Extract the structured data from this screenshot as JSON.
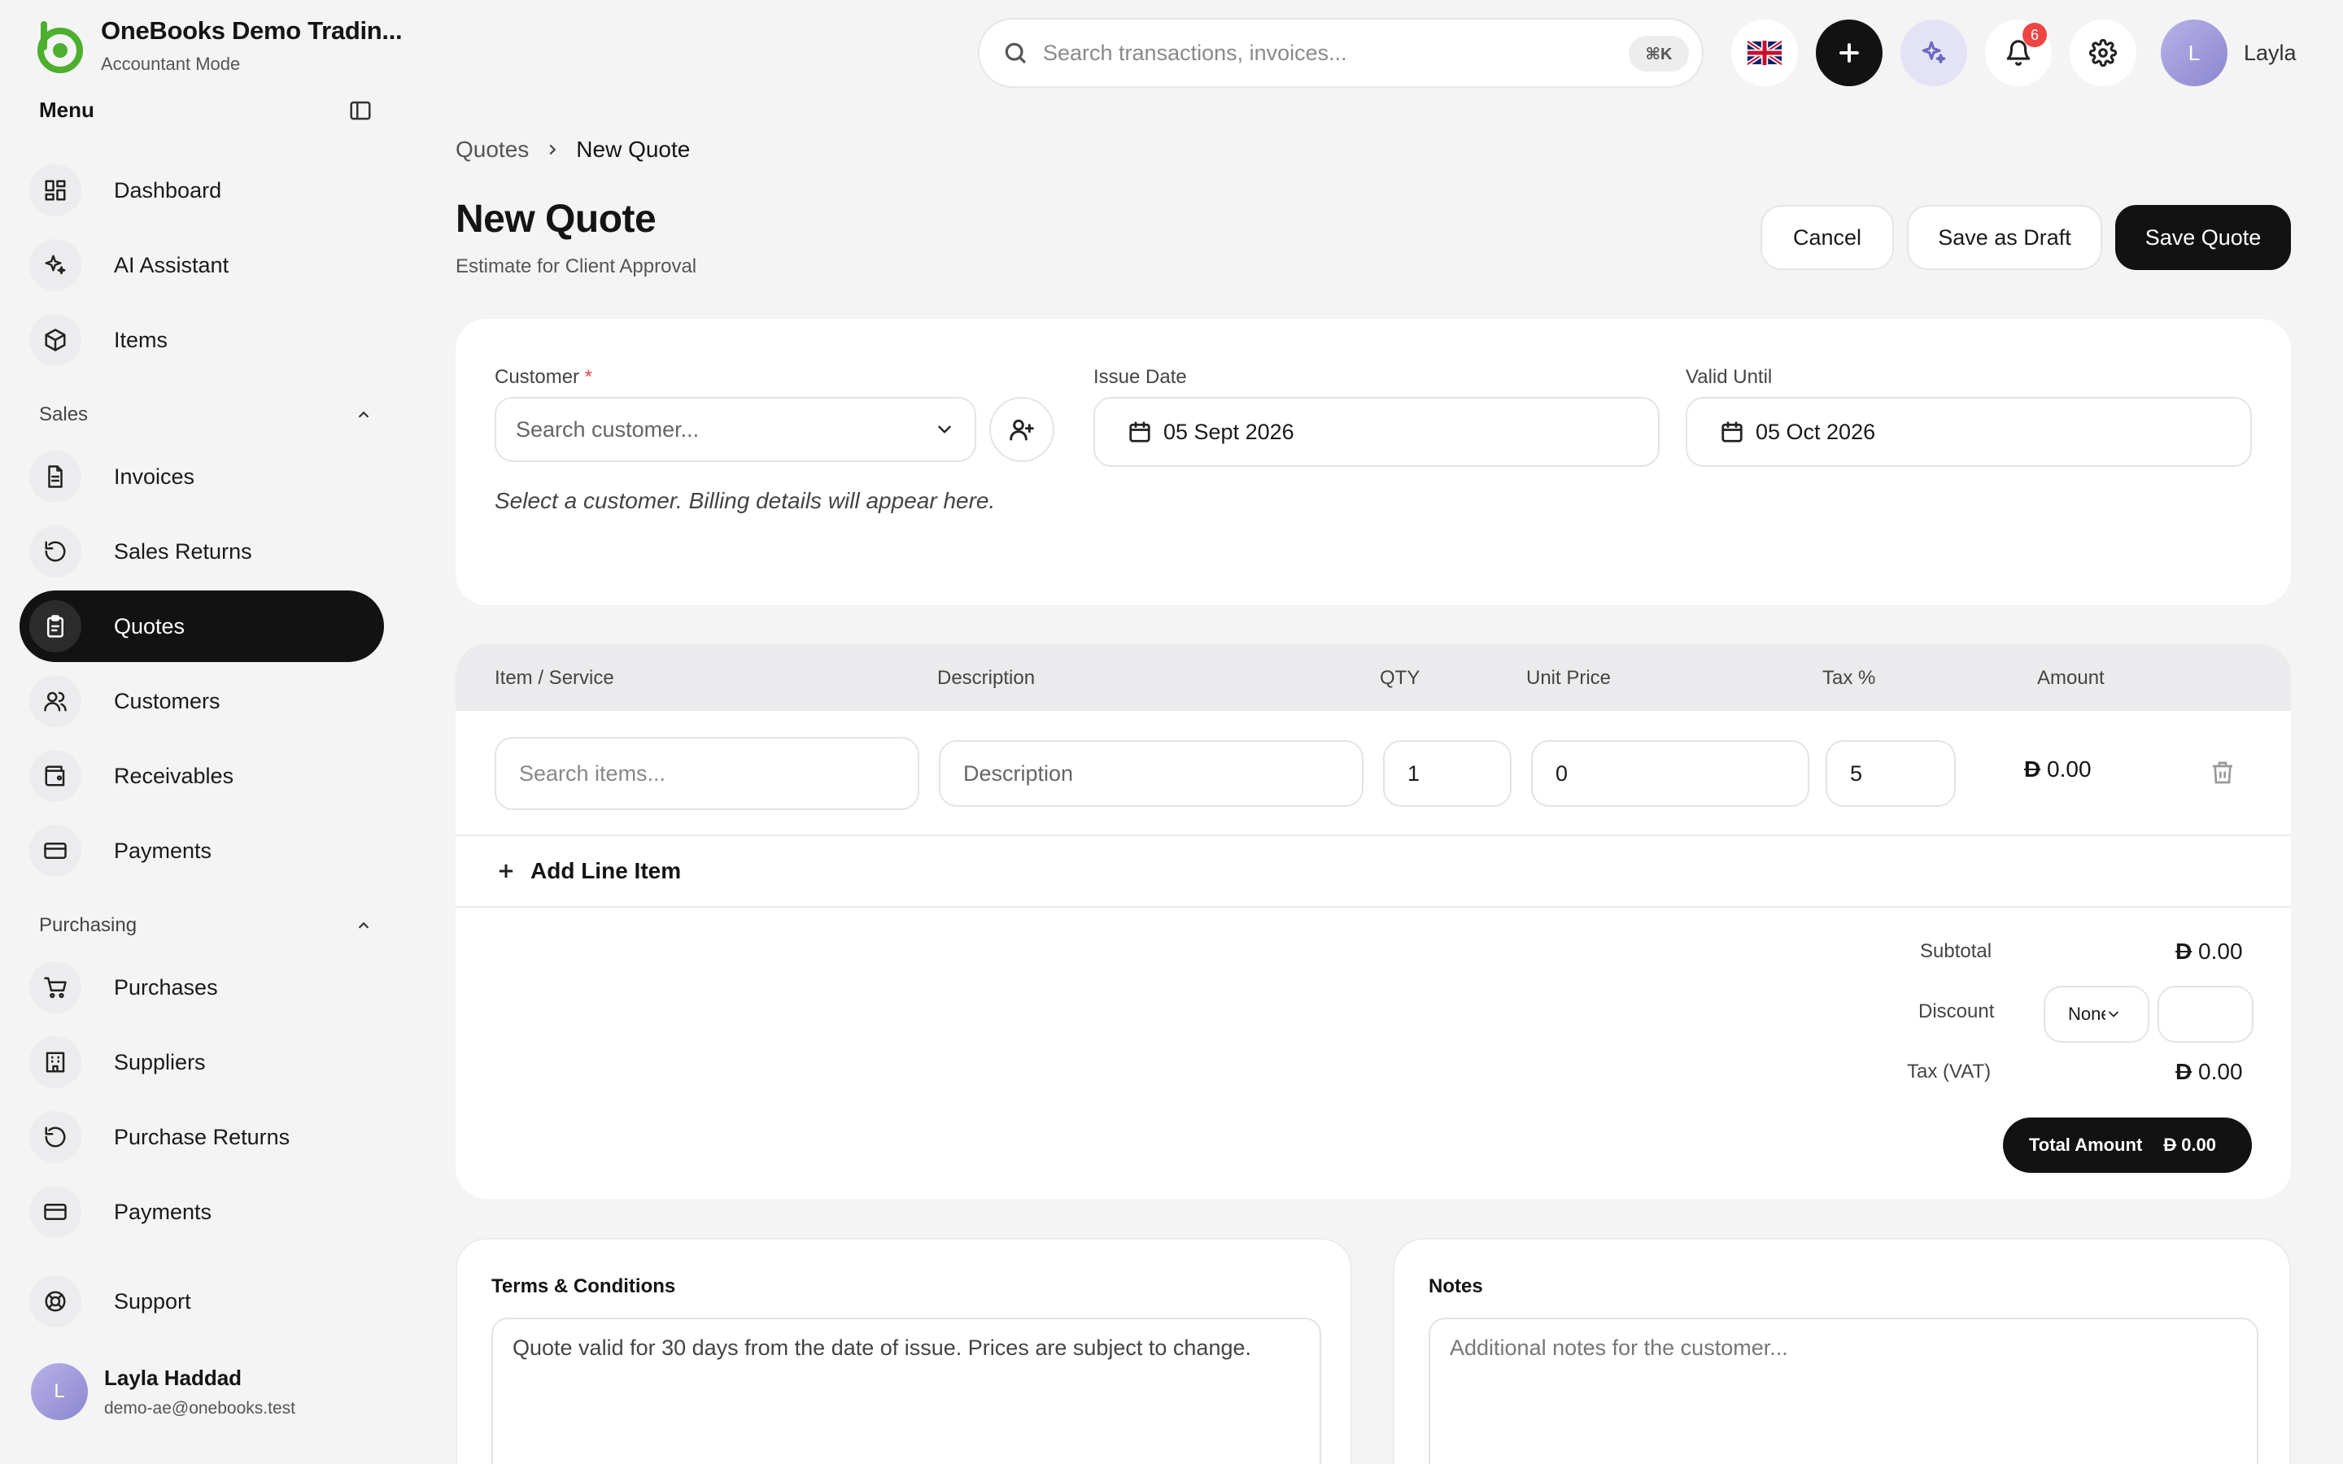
{
  "brand": {
    "name": "OneBooks Demo Tradin...",
    "mode": "Accountant Mode"
  },
  "menu": {
    "title": "Menu"
  },
  "nav_main": [
    {
      "label": "Dashboard",
      "icon": "dashboard-icon"
    },
    {
      "label": "AI Assistant",
      "icon": "sparkle-icon"
    },
    {
      "label": "Items",
      "icon": "box-icon"
    }
  ],
  "sections": {
    "sales": "Sales",
    "purchasing": "Purchasing"
  },
  "nav_sales": [
    {
      "label": "Invoices",
      "icon": "document-icon"
    },
    {
      "label": "Sales Returns",
      "icon": "return-icon"
    },
    {
      "label": "Quotes",
      "icon": "clipboard-icon",
      "active": true
    },
    {
      "label": "Customers",
      "icon": "users-icon"
    },
    {
      "label": "Receivables",
      "icon": "wallet-icon"
    },
    {
      "label": "Payments",
      "icon": "card-icon"
    }
  ],
  "nav_purchasing": [
    {
      "label": "Purchases",
      "icon": "cart-icon"
    },
    {
      "label": "Suppliers",
      "icon": "building-icon"
    },
    {
      "label": "Purchase Returns",
      "icon": "return-icon"
    },
    {
      "label": "Payments",
      "icon": "card-icon"
    }
  ],
  "support": {
    "label": "Support"
  },
  "user": {
    "initial": "L",
    "name": "Layla Haddad",
    "email": "demo-ae@onebooks.test",
    "first_name": "Layla"
  },
  "search": {
    "placeholder": "Search transactions, invoices...",
    "shortcut": "⌘K"
  },
  "notifications": {
    "count": "6"
  },
  "breadcrumb": {
    "parent": "Quotes",
    "current": "New Quote"
  },
  "page": {
    "title": "New Quote",
    "subtitle": "Estimate for Client Approval"
  },
  "actions": {
    "cancel": "Cancel",
    "draft": "Save as Draft",
    "save": "Save Quote"
  },
  "form": {
    "customer_label": "Customer",
    "customer_required": "*",
    "customer_placeholder": "Search customer...",
    "issue_label": "Issue Date",
    "issue_value": "05 Sept 2026",
    "valid_label": "Valid Until",
    "valid_value": "05 Oct 2026",
    "hint": "Select a customer. Billing details will appear here."
  },
  "table": {
    "headers": [
      "Item / Service",
      "Description",
      "QTY",
      "Unit Price",
      "Tax %",
      "Amount"
    ],
    "row": {
      "item_placeholder": "Search items...",
      "desc_placeholder": "Description",
      "qty": "1",
      "price": "0",
      "tax": "5",
      "amount": "0.00"
    },
    "add_line": "Add Line Item"
  },
  "currency_symbol": "D",
  "totals": {
    "subtotal_label": "Subtotal",
    "subtotal": "0.00",
    "discount_label": "Discount",
    "discount_type": "None",
    "tax_label": "Tax (VAT)",
    "tax": "0.00",
    "total_label": "Total Amount",
    "total": "0.00"
  },
  "terms": {
    "title": "Terms & Conditions",
    "value": "Quote valid for 30 days from the date of issue. Prices are subject to change."
  },
  "notes": {
    "title": "Notes",
    "placeholder": "Additional notes for the customer..."
  }
}
